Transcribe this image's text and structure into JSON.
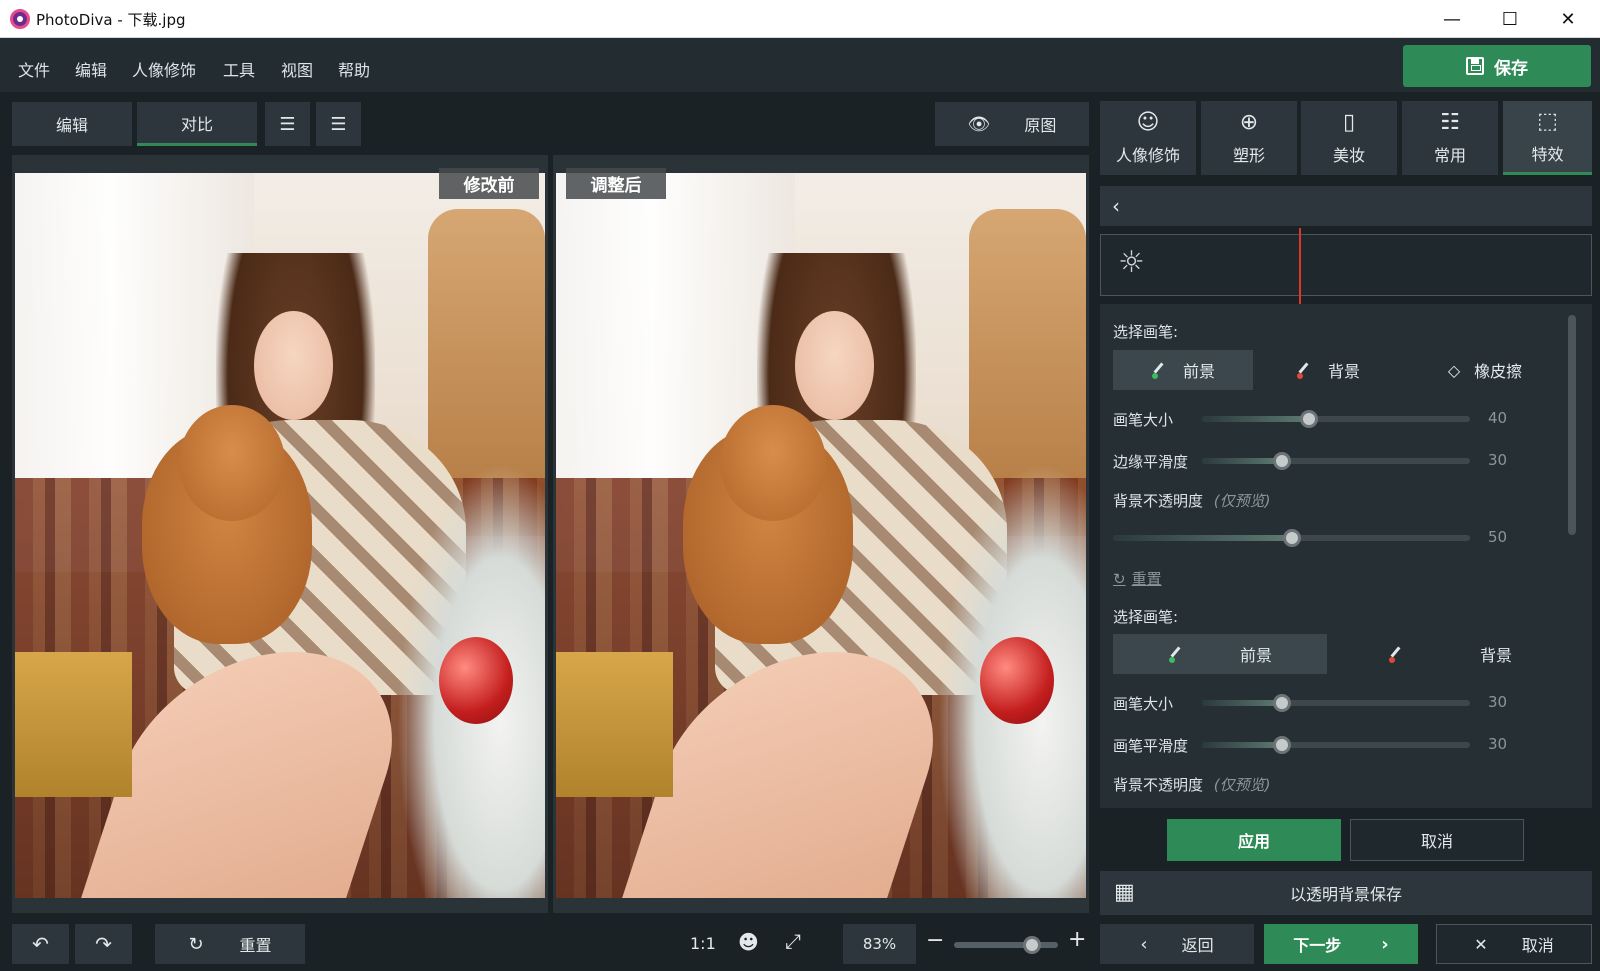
{
  "window": {
    "title": "PhotoDiva - 下载.jpg",
    "minimize": "—",
    "maximize": "☐",
    "close": "✕"
  },
  "menu": [
    "文件",
    "编辑",
    "人像修饰",
    "工具",
    "视图",
    "帮助"
  ],
  "save_button": "保存",
  "toolbar": {
    "edit": "编辑",
    "compare": "对比",
    "original": "原图"
  },
  "photos": {
    "before_label": "修改前",
    "after_label": "调整后"
  },
  "right_tabs": [
    {
      "label": "人像修饰",
      "icon": "portrait-icon"
    },
    {
      "label": "塑形",
      "icon": "reshape-icon"
    },
    {
      "label": "美妆",
      "icon": "makeup-icon"
    },
    {
      "label": "常用",
      "icon": "sliders-icon"
    },
    {
      "label": "特效",
      "icon": "effects-icon"
    }
  ],
  "brush_section_1": {
    "title": "选择画笔:",
    "buttons": [
      "前景",
      "背景",
      "橡皮擦"
    ],
    "sliders": [
      {
        "label": "画笔大小",
        "value": 40,
        "fraction": 0.4
      },
      {
        "label": "边缘平滑度",
        "value": 30,
        "fraction": 0.3
      }
    ],
    "opacity_label": "背景不透明度",
    "opacity_note": "(仅预览)",
    "opacity_value": 50,
    "opacity_fraction": 0.5,
    "reset": "重置"
  },
  "brush_section_2": {
    "title": "选择画笔:",
    "buttons": [
      "前景",
      "背景"
    ],
    "sliders": [
      {
        "label": "画笔大小",
        "value": 30,
        "fraction": 0.3
      },
      {
        "label": "画笔平滑度",
        "value": 30,
        "fraction": 0.3
      }
    ],
    "opacity_label": "背景不透明度",
    "opacity_note": "(仅预览)"
  },
  "actions": {
    "apply": "应用",
    "cancel": "取消",
    "save_transparent": "以透明背景保存"
  },
  "bottom": {
    "reset": "重置",
    "ratio": "1:1",
    "zoom": "83%",
    "zoom_fraction": 0.75,
    "back": "返回",
    "next": "下一步",
    "cancel": "取消"
  },
  "colors": {
    "accent": "#2e8b57",
    "background": "#1b2226",
    "panel": "#2c363c"
  }
}
